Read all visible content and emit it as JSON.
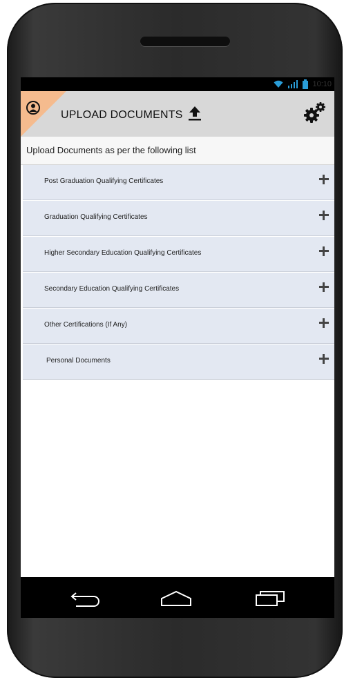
{
  "status": {
    "time": "10:10"
  },
  "appbar": {
    "title": "UPLOAD DOCUMENTS"
  },
  "subtitle": "Upload Documents as per the following list",
  "items": [
    {
      "label": "Post Graduation Qualifying Certificates"
    },
    {
      "label": "Graduation Qualifying Certificates"
    },
    {
      "label": "Higher Secondary Education Qualifying Certificates"
    },
    {
      "label": "Secondary Education Qualifying Certificates"
    },
    {
      "label": "Other Certifications (If Any)"
    },
    {
      "label": "Personal Documents"
    }
  ],
  "colors": {
    "accent": "#f5bb8e",
    "list_bg": "#e3e8f2",
    "status_icons": "#2a9dd8"
  },
  "icons": [
    "wifi-icon",
    "signal-icon",
    "battery-icon",
    "avatar-icon",
    "upload-icon",
    "gear-icon",
    "plus-icon",
    "back-icon",
    "home-icon",
    "recents-icon"
  ]
}
